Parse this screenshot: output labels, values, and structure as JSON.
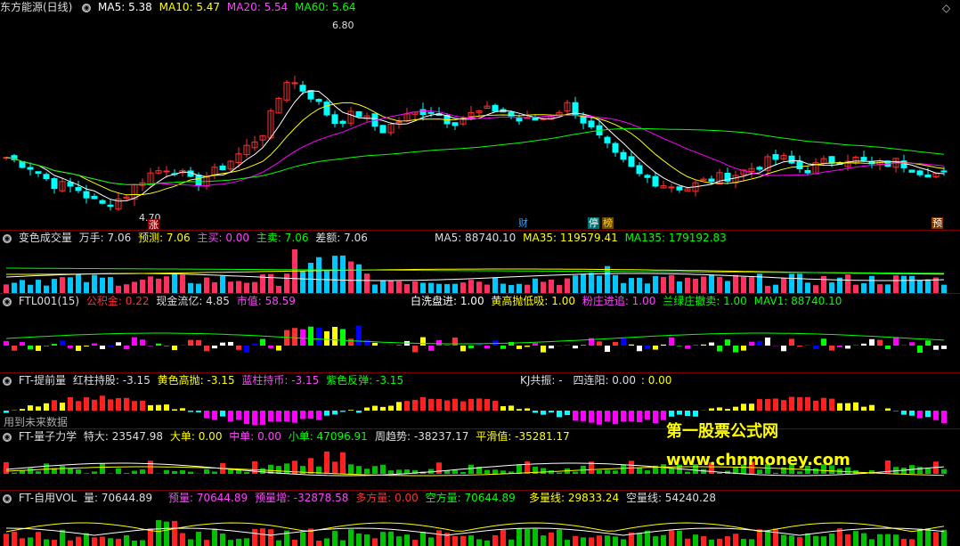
{
  "main": {
    "title": "东方能源(日线)",
    "ma5": "MA5: 5.38",
    "ma10": "MA10: 5.47",
    "ma20": "MA20: 5.54",
    "ma60": "MA60: 5.64",
    "high_label": "6.80",
    "low_label": "4.70",
    "tag_zhang": "涨",
    "tag_cai": "财",
    "tag_ting": "停",
    "tag_bang": "榜",
    "tag_yu": "预",
    "colors": {
      "ma5": "#ffffff",
      "ma10": "#ffff00",
      "ma20": "#ff00ff",
      "ma60": "#00ff00",
      "up": "#ff3030",
      "down": "#00ffff"
    }
  },
  "vol": {
    "title": "变色成交量",
    "wanshou": "万手: 7.06",
    "yuce": "预测: 7.06",
    "zhumai": "主买: 0.00",
    "zhumai2": "主卖: 7.06",
    "chae": "差额: 7.06",
    "ma5": "MA5: 88740.10",
    "ma35": "MA35: 119579.41",
    "ma135": "MA135: 179192.83"
  },
  "ftl": {
    "title": "FTL001(15)",
    "gongjijin": "公积金: 0.22",
    "xianjin": "现金流亿: 4.85",
    "shizhi": "市值: 58.59",
    "baixian": "白洗盘进: 1.00",
    "huanggao": "黄高抛低吸: 1.00",
    "fenzhuang": "粉庄进追: 1.00",
    "lanlv": "兰绿庄撤卖: 1.00",
    "mav1": "MAV1: 88740.10"
  },
  "tiqian": {
    "title": "FT-提前量",
    "hongzhu": "红柱持股: -3.15",
    "huangse": "黄色高抛: -3.15",
    "lanzhu": "蓝柱持币: -3.15",
    "zise": "紫色反弹: -3.15",
    "kj": "KJ共振: -",
    "silian": "四连阳: 0.00",
    "zero": ": 0.00",
    "future_note": "用到未来数据"
  },
  "liangzi": {
    "title": "FT-量子力学",
    "teda": "特大: 23547.98",
    "dadan": "大单: 0.00",
    "zhongdan": "中单: 0.00",
    "xiaodan": "小单: 47096.91",
    "zhouqushi": "周趋势: -38237.17",
    "pinghua": "平滑值: -35281.17"
  },
  "zivol": {
    "title": "FT-自用VOL",
    "liang": "量: 70644.89",
    "yuliang": "预量: 70644.89",
    "yuliangzeng": "预量增: -32878.58",
    "duofang": "多方量: 0.00",
    "kongfang": "空方量: 70644.89",
    "duoliangxian": "多量线: 29833.24",
    "kongliangxian": "空量线: 54240.28"
  },
  "watermark": {
    "line1": "第一股票公式网",
    "line2": "www.chnmoney.com"
  }
}
